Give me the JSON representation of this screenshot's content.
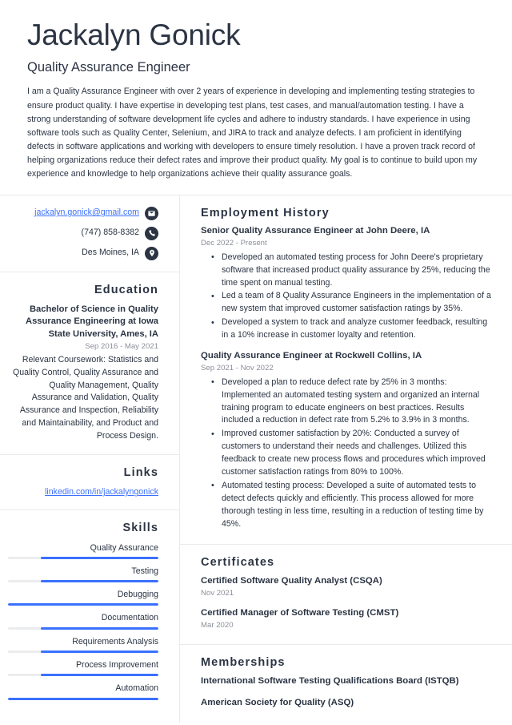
{
  "header": {
    "name": "Jackalyn Gonick",
    "job_title": "Quality Assurance Engineer",
    "summary": "I am a Quality Assurance Engineer with over 2 years of experience in developing and implementing testing strategies to ensure product quality. I have expertise in developing test plans, test cases, and manual/automation testing. I have a strong understanding of software development life cycles and adhere to industry standards. I have experience in using software tools such as Quality Center, Selenium, and JIRA to track and analyze defects. I am proficient in identifying defects in software applications and working with developers to ensure timely resolution. I have a proven track record of helping organizations reduce their defect rates and improve their product quality. My goal is to continue to build upon my experience and knowledge to help organizations achieve their quality assurance goals."
  },
  "contact": {
    "email": "jackalyn.gonick@gmail.com",
    "phone": "(747) 858-8382",
    "location": "Des Moines, IA",
    "email_icon": "envelope-icon",
    "phone_icon": "phone-icon",
    "location_icon": "map-pin-icon"
  },
  "education": {
    "heading": "Education",
    "degree": "Bachelor of Science in Quality Assurance Engineering at Iowa State University, Ames, IA",
    "dates": "Sep 2016 - May 2021",
    "coursework": "Relevant Coursework: Statistics and Quality Control, Quality Assurance and Quality Management, Quality Assurance and Validation, Quality Assurance and Inspection, Reliability and Maintainability, and Product and Process Design."
  },
  "links": {
    "heading": "Links",
    "items": [
      {
        "label": "linkedin.com/in/jackalyngonick"
      }
    ]
  },
  "skills": {
    "heading": "Skills",
    "items": [
      {
        "label": "Quality Assurance",
        "level": 78
      },
      {
        "label": "Testing",
        "level": 78
      },
      {
        "label": "Debugging",
        "level": 100
      },
      {
        "label": "Documentation",
        "level": 78
      },
      {
        "label": "Requirements Analysis",
        "level": 78
      },
      {
        "label": "Process Improvement",
        "level": 78
      },
      {
        "label": "Automation",
        "level": 100
      }
    ]
  },
  "employment": {
    "heading": "Employment History",
    "jobs": [
      {
        "role": "Senior Quality Assurance Engineer at John Deere, IA",
        "dates": "Dec 2022 - Present",
        "bullets": [
          "Developed an automated testing process for John Deere's proprietary software that increased product quality assurance by 25%, reducing the time spent on manual testing.",
          "Led a team of 8 Quality Assurance Engineers in the implementation of a new system that improved customer satisfaction ratings by 35%.",
          "Developed a system to track and analyze customer feedback, resulting in a 10% increase in customer loyalty and retention."
        ]
      },
      {
        "role": "Quality Assurance Engineer at Rockwell Collins, IA",
        "dates": "Sep 2021 - Nov 2022",
        "bullets": [
          "Developed a plan to reduce defect rate by 25% in 3 months: Implemented an automated testing system and organized an internal training program to educate engineers on best practices. Results included a reduction in defect rate from 5.2% to 3.9% in 3 months.",
          "Improved customer satisfaction by 20%: Conducted a survey of customers to understand their needs and challenges. Utilized this feedback to create new process flows and procedures which improved customer satisfaction ratings from 80% to 100%.",
          "Automated testing process: Developed a suite of automated tests to detect defects quickly and efficiently. This process allowed for more thorough testing in less time, resulting in a reduction of testing time by 45%."
        ]
      }
    ]
  },
  "certificates": {
    "heading": "Certificates",
    "items": [
      {
        "name": "Certified Software Quality Analyst (CSQA)",
        "date": "Nov 2021"
      },
      {
        "name": "Certified Manager of Software Testing (CMST)",
        "date": "Mar 2020"
      }
    ]
  },
  "memberships": {
    "heading": "Memberships",
    "items": [
      {
        "name": "International Software Testing Qualifications Board (ISTQB)"
      },
      {
        "name": "American Society for Quality (ASQ)"
      }
    ]
  },
  "colors": {
    "text": "#2b3443",
    "muted": "#8b8f99",
    "accent": "#3b71fe",
    "divider": "#e9eaee",
    "track": "#ebecee"
  }
}
